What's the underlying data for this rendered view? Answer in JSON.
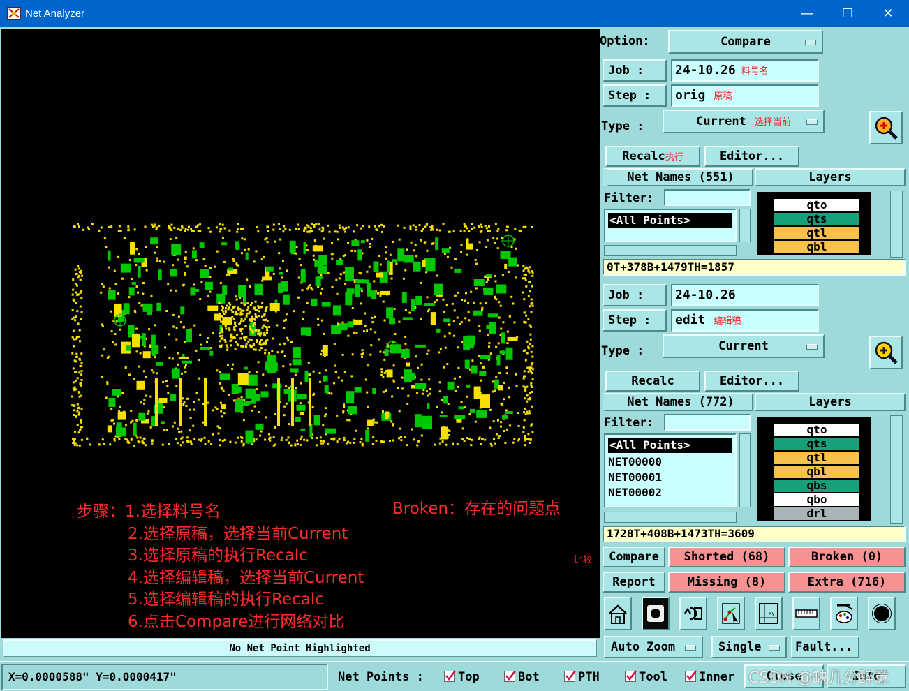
{
  "window": {
    "title": "Net Analyzer",
    "minimize": "—",
    "maximize": "☐",
    "close": "✕"
  },
  "canvas": {
    "status": "No Net Point Highlighted",
    "annotations": {
      "steps": [
        "步骤：1.选择料号名",
        "2.选择原稿，选择当前Current",
        "3.选择原稿的执行Recalc",
        "4.选择编辑稿，选择当前Current",
        "5.选择编辑稿的执行Recalc",
        "6.点击Compare进行网络对比"
      ],
      "broken_note": "Broken：存在的问题点",
      "compare_note": "比较"
    }
  },
  "panel": {
    "option_label": "Option:",
    "option_value": "Compare",
    "top": {
      "job_label": "Job   :",
      "job_value": "24-10.26",
      "job_note": "料号名",
      "step_label": "Step  :",
      "step_value": "orig",
      "step_note": "原稿",
      "type_label": "Type  :",
      "type_value": "Current",
      "type_note": "选择当前",
      "recalc": "Recalc",
      "recalc_note": "执行",
      "editor": "Editor...",
      "netnames": "Net Names (551)",
      "layers_header": "Layers",
      "filter_label": "Filter:",
      "list_items": [
        "<All Points>"
      ],
      "layers": [
        {
          "name": "qto",
          "color": "#ffffff"
        },
        {
          "name": "qts",
          "color": "#18a07a"
        },
        {
          "name": "qtl",
          "color": "#f7c24a"
        },
        {
          "name": "qbl",
          "color": "#f7c24a"
        }
      ],
      "summary": "0T+378B+1479TH=1857"
    },
    "bottom": {
      "job_label": "Job   :",
      "job_value": "24-10.26",
      "step_label": "Step  :",
      "step_value": "edit",
      "step_note": "编辑稿",
      "type_label": "Type  :",
      "type_value": "Current",
      "recalc": "Recalc",
      "editor": "Editor...",
      "netnames": "Net Names (772)",
      "layers_header": "Layers",
      "filter_label": "Filter:",
      "list_items": [
        "<All Points>",
        "NET00000",
        "NET00001",
        "NET00002"
      ],
      "layers": [
        {
          "name": "qto",
          "color": "#ffffff"
        },
        {
          "name": "qts",
          "color": "#18a07a"
        },
        {
          "name": "qtl",
          "color": "#f7c24a"
        },
        {
          "name": "qbl",
          "color": "#f7c24a"
        },
        {
          "name": "qbs",
          "color": "#18a07a"
        },
        {
          "name": "qbo",
          "color": "#ffffff"
        },
        {
          "name": "drl",
          "color": "#a8b4b8"
        }
      ],
      "summary": "1728T+408B+1473TH=3609"
    },
    "compare": "Compare",
    "report": "Report",
    "shorted": "Shorted (68)",
    "broken": "Broken (0)",
    "missing": "Missing (8)",
    "extra": "Extra (716)",
    "auto_zoom": "Auto Zoom",
    "single": "Single",
    "fault": "Fault..."
  },
  "bottom_bar": {
    "coords": "X=0.0000588\" Y=0.0000417\"",
    "net_points_label": "Net Points :",
    "checks": [
      {
        "label": "Top",
        "checked": true
      },
      {
        "label": "Bot",
        "checked": true
      },
      {
        "label": "PTH",
        "checked": true
      },
      {
        "label": "Tool",
        "checked": true
      },
      {
        "label": "Inner",
        "checked": true
      }
    ],
    "close": "Close",
    "info": "Info",
    "watermark": "CSDN @缺几分醉意"
  },
  "colors": {
    "titlebar": "#0066cc",
    "panel": "#9fdada",
    "pink": "#f59393",
    "teal": "#18a07a",
    "pcb_yellow": "#f7e000",
    "pcb_green": "#00c800",
    "annotation_red": "#ee2020"
  }
}
